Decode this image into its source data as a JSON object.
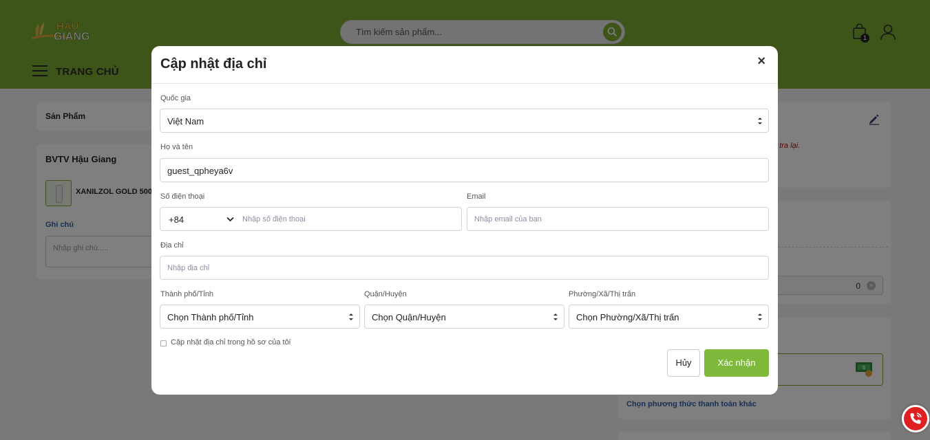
{
  "header": {
    "logo_text_top": "HẬU",
    "logo_text_bottom": "GIANG",
    "search_placeholder": "Tìm kiếm sản phẩm...",
    "cart_count": "1",
    "nav_home": "TRANG CHỦ"
  },
  "page": {
    "products_heading": "Sản Phẩm",
    "store_name": "BVTV Hậu Giang",
    "product_name": "XANILZOL GOLD 500S",
    "note_label": "Ghi chú",
    "note_placeholder": "Nhập ghi chú.....",
    "warning_text": "m tra lại.",
    "coin_value": "0",
    "other_payment_link": "Chọn phương thức thanh toán khác"
  },
  "modal": {
    "title": "Cập nhật địa chỉ",
    "close": "×",
    "country_label": "Quốc gia",
    "country_value": "Việt Nam",
    "fullname_label": "Họ và tên",
    "fullname_value": "guest_qpheya6v",
    "phone_label": "Số điện thoại",
    "phone_code": "+84",
    "phone_placeholder": "Nhập số điện thoại",
    "email_label": "Email",
    "email_placeholder": "Nhập email của bạn",
    "address_label": "Địa chỉ",
    "address_placeholder": "Nhập địa chỉ",
    "city_label": "Thành phố/Tỉnh",
    "city_value": "Chọn Thành phố/Tỉnh",
    "district_label": "Quận/Huyện",
    "district_value": "Chọn Quận/Huyện",
    "ward_label": "Phường/Xã/Thị trấn",
    "ward_value": "Chọn Phường/Xã/Thị trấn",
    "update_profile_label": "Cập nhật địa chỉ trong hồ sơ của tôi",
    "cancel_label": "Hủy",
    "confirm_label": "Xác nhận"
  },
  "colors": {
    "brand_green": "#7aab30",
    "confirm_green": "#7fb93c",
    "overlay": "rgba(0,0,0,0.5)",
    "fab_red": "#e02020"
  }
}
